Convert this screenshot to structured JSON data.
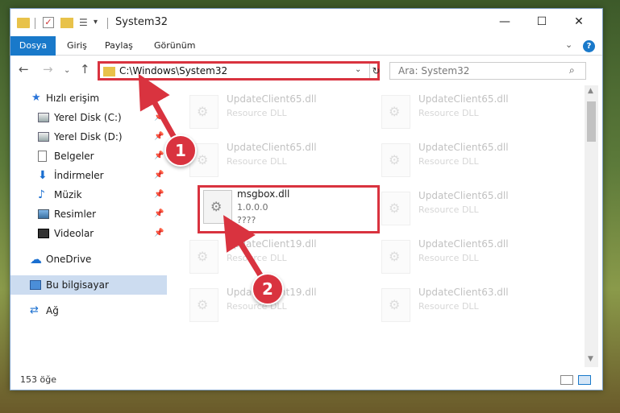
{
  "titlebar": {
    "title": "System32",
    "minimize_glyph": "—",
    "maximize_glyph": "☐",
    "close_glyph": "✕",
    "properties_glyph": "☰",
    "customize_glyph": "▾"
  },
  "ribbon": {
    "tabs": [
      "Dosya",
      "Giriş",
      "Paylaş",
      "Görünüm"
    ],
    "expand_glyph": "⌄",
    "help_glyph": "?"
  },
  "navbar": {
    "back_glyph": "←",
    "forward_glyph": "→",
    "recent_glyph": "⌄",
    "up_glyph": "↑",
    "address": "C:\\Windows\\System32",
    "address_drop_glyph": "⌄",
    "refresh_glyph": "↻",
    "search_placeholder": "Ara: System32",
    "search_glyph": "⌕"
  },
  "sidebar": {
    "items": [
      {
        "label": "Hızlı erişim",
        "icon": "star-icon",
        "glyph": "★",
        "pinned": false
      },
      {
        "label": "Yerel Disk (C:)",
        "icon": "disk-icon",
        "pinned": true
      },
      {
        "label": "Yerel Disk (D:)",
        "icon": "disk-icon",
        "pinned": true
      },
      {
        "label": "Belgeler",
        "icon": "document-icon",
        "pinned": true
      },
      {
        "label": "İndirmeler",
        "icon": "download-icon",
        "glyph": "⬇",
        "pinned": true
      },
      {
        "label": "Müzik",
        "icon": "music-icon",
        "glyph": "♪",
        "pinned": true
      },
      {
        "label": "Resimler",
        "icon": "pictures-icon",
        "pinned": true
      },
      {
        "label": "Videolar",
        "icon": "video-icon",
        "pinned": true
      },
      {
        "label": "OneDrive",
        "icon": "cloud-icon",
        "glyph": "☁"
      },
      {
        "label": "Bu bilgisayar",
        "icon": "computer-icon",
        "selected": true
      },
      {
        "label": "Ağ",
        "icon": "network-icon",
        "glyph": "⇄"
      }
    ],
    "pin_glyph": "📌"
  },
  "files": [
    {
      "name": "UpdateClient65.dll",
      "line2": "Resource DLL",
      "line3": "",
      "faded": true
    },
    {
      "name": "UpdateClient65.dll",
      "line2": "Resource DLL",
      "line3": "",
      "faded": true
    },
    {
      "name": "UpdateClient65.dll",
      "line2": "Resource DLL",
      "line3": "",
      "faded": true
    },
    {
      "name": "UpdateClient65.dll",
      "line2": "Resource DLL",
      "line3": "",
      "faded": true
    },
    {
      "name": "msgbox.dll",
      "line2": "1.0.0.0",
      "line3": "????",
      "faded": false,
      "highlight": true
    },
    {
      "name": "UpdateClient65.dll",
      "line2": "Resource DLL",
      "line3": "",
      "faded": true
    },
    {
      "name": "UpdateClient19.dll",
      "line2": "Resource DLL",
      "line3": "",
      "faded": true
    },
    {
      "name": "UpdateClient65.dll",
      "line2": "Resource DLL",
      "line3": "",
      "faded": true
    },
    {
      "name": "UpdateClient19.dll",
      "line2": "Resource DLL",
      "line3": "",
      "faded": true
    },
    {
      "name": "UpdateClient63.dll",
      "line2": "Resource DLL",
      "line3": "",
      "faded": true
    }
  ],
  "scrollbar": {
    "up_glyph": "▲",
    "down_glyph": "▼"
  },
  "status": {
    "item_count": "153 öğe"
  },
  "annotations": {
    "badges": [
      "1",
      "2"
    ],
    "accent_color": "#d9333f"
  },
  "colors": {
    "accent": "#1979ca",
    "highlight_red": "#d9333f",
    "selection": "#ccdcf0"
  }
}
